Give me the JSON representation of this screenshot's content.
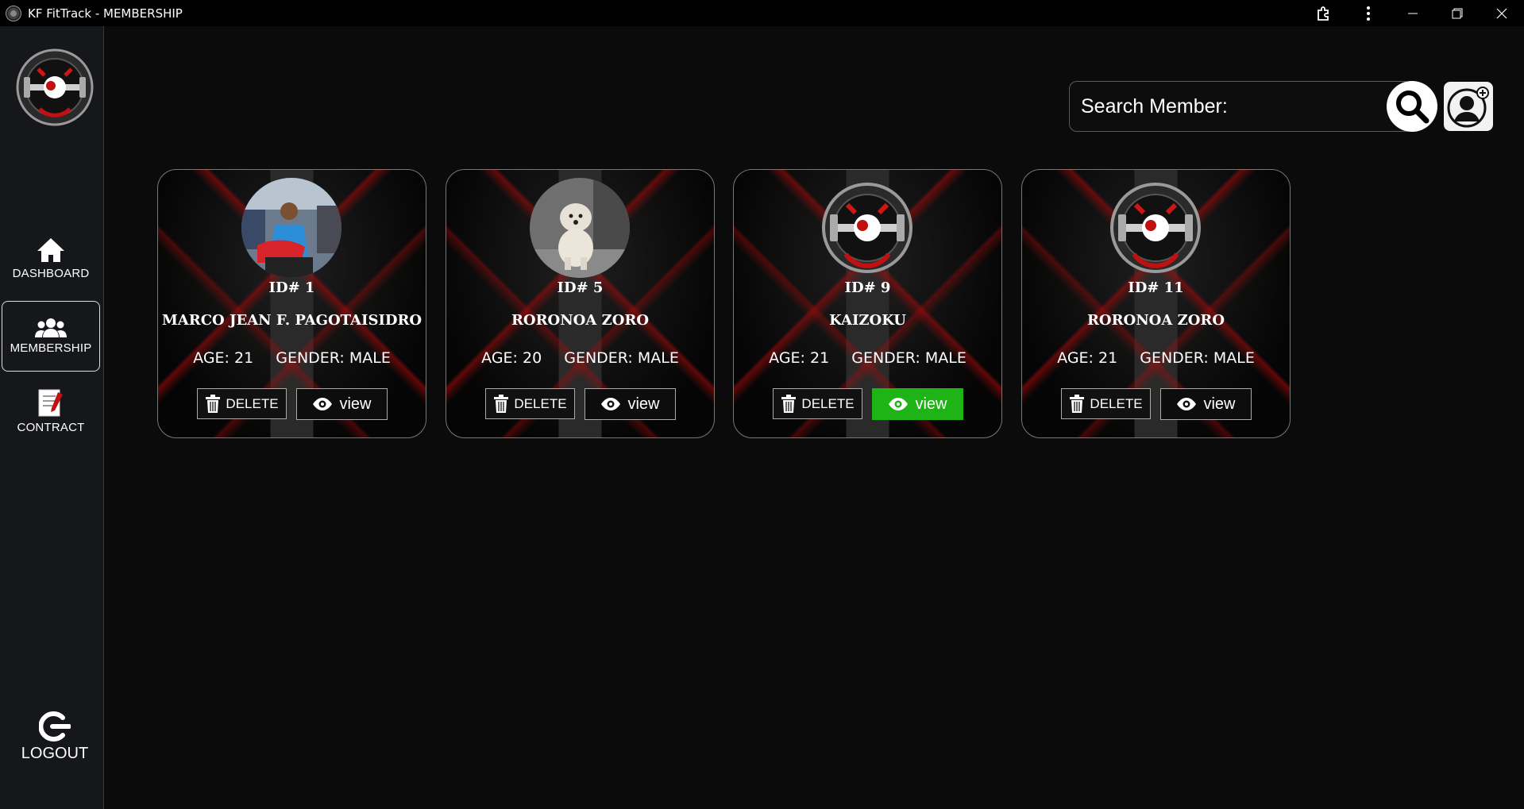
{
  "window": {
    "title": "KF FitTrack - MEMBERSHIP"
  },
  "sidebar": {
    "items": [
      {
        "label": "DASHBOARD",
        "icon": "home-icon"
      },
      {
        "label": "MEMBERSHIP",
        "icon": "users-icon",
        "active": true
      },
      {
        "label": "CONTRACT",
        "icon": "contract-icon"
      }
    ],
    "logout_label": "LOGOUT"
  },
  "search": {
    "placeholder": "Search Member:"
  },
  "members": [
    {
      "id_label": "ID# 1",
      "name": "MARCO JEAN F. PAGOTAISIDRO",
      "age": "AGE: 21",
      "gender": "GENDER: MALE",
      "delete_label": "DELETE",
      "view_label": "view",
      "photo": "person-photo"
    },
    {
      "id_label": "ID# 5",
      "name": "RORONOA ZORO",
      "age": "AGE: 20",
      "gender": "GENDER: MALE",
      "delete_label": "DELETE",
      "view_label": "view",
      "photo": "dog-photo"
    },
    {
      "id_label": "ID# 9",
      "name": "KAIZOKU",
      "age": "AGE: 21",
      "gender": "GENDER: MALE",
      "delete_label": "DELETE",
      "view_label": "view",
      "photo": "gym-logo"
    },
    {
      "id_label": "ID# 11",
      "name": "RORONOA ZORO",
      "age": "AGE: 21",
      "gender": "GENDER: MALE",
      "delete_label": "DELETE",
      "view_label": "view",
      "photo": "gym-logo"
    }
  ],
  "colors": {
    "view_hover": "#1fb416",
    "sidebar_bg": "#15171a",
    "accent_red": "#aa0a0a"
  }
}
